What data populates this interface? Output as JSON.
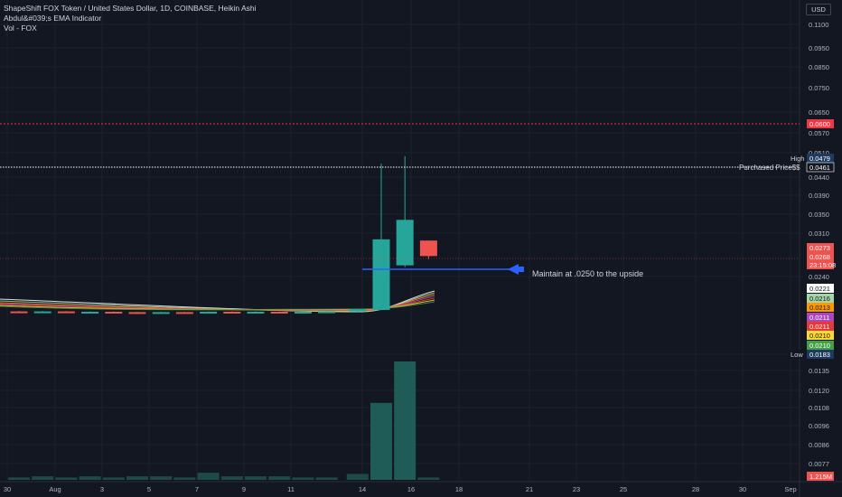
{
  "header": {
    "title_line": "ShapeShift FOX Token / United States Dollar, 1D, COINBASE, Heikin Ashi",
    "indicator_1": "Abdul&#039;s EMA Indicator",
    "indicator_2": "Vol - FOX",
    "currency": "USD"
  },
  "annotations": {
    "maintain_text": "Maintain at .0250 to the upside",
    "purchased_label": "Purchased Price$$",
    "high_label": "High",
    "low_label": "Low"
  },
  "colors": {
    "background": "#131722",
    "grid": "#1e222d",
    "up": "#26a69a",
    "down": "#ef5350",
    "horizontal_line": "#2962ff",
    "dotted_line_red": "#f23645",
    "dotted_line_white": "#ffffff"
  },
  "chart_data": {
    "type": "candlestick",
    "ylim": [
      0.0183,
      0.11
    ],
    "y_ticks": [
      "0.1100",
      "0.0950",
      "0.0850",
      "0.0750",
      "0.0650",
      "0.0570",
      "0.0510",
      "0.0440",
      "0.0390",
      "0.0350",
      "0.0310",
      "0.0240",
      "0.0183",
      "0.0135",
      "0.0120",
      "0.0108",
      "0.0096",
      "0.0086",
      "0.0077"
    ],
    "x_ticks": [
      "30",
      "Aug",
      "3",
      "5",
      "7",
      "9",
      "11",
      "14",
      "16",
      "18",
      "21",
      "23",
      "25",
      "28",
      "30",
      "Sep"
    ],
    "price_tags": [
      {
        "label": "",
        "value": "0.0600",
        "color": "#f23645"
      },
      {
        "label": "High",
        "value": "0.0479",
        "color": "#1e3a5f"
      },
      {
        "label": "Purchased Price$$",
        "value": "0.0461",
        "color": "#131722"
      },
      {
        "label": "",
        "value": "0.0273",
        "color": "#ef5350"
      },
      {
        "label": "",
        "value": "0.0268",
        "color": "#ef5350"
      },
      {
        "label": "",
        "value": "23:15:08",
        "color": "#ef5350"
      },
      {
        "label": "",
        "value": "0.0221",
        "color": "#ffffff"
      },
      {
        "label": "",
        "value": "0.0216",
        "color": "#a5d6a7"
      },
      {
        "label": "",
        "value": "0.0213",
        "color": "#ff9800"
      },
      {
        "label": "",
        "value": "0.0211",
        "color": "#ab47bc"
      },
      {
        "label": "",
        "value": "0.0211",
        "color": "#e53935"
      },
      {
        "label": "",
        "value": "0.0210",
        "color": "#fdd835"
      },
      {
        "label": "",
        "value": "0.0210",
        "color": "#43a047"
      },
      {
        "label": "Low",
        "value": "0.0183",
        "color": "#1e3a5f"
      },
      {
        "label": "",
        "value": "1.215M",
        "color": "#ef5350"
      }
    ],
    "candles_note": "Daily Heikin Ashi candles, roughly flat near 0.021 from late July until a spike on Aug 15-16 and a red candle on Aug 17",
    "candles": [
      {
        "date": "Jul 31",
        "open": 0.0212,
        "close": 0.0211,
        "high": 0.0213,
        "low": 0.0209
      },
      {
        "date": "Aug 1",
        "open": 0.0211,
        "close": 0.0212,
        "high": 0.0213,
        "low": 0.021
      },
      {
        "date": "Aug 2",
        "open": 0.0212,
        "close": 0.021,
        "high": 0.0213,
        "low": 0.0209
      },
      {
        "date": "Aug 3",
        "open": 0.021,
        "close": 0.0211,
        "high": 0.0212,
        "low": 0.0209
      },
      {
        "date": "Aug 4",
        "open": 0.0211,
        "close": 0.021,
        "high": 0.0212,
        "low": 0.0209
      },
      {
        "date": "Aug 5",
        "open": 0.021,
        "close": 0.0209,
        "high": 0.0211,
        "low": 0.0208
      },
      {
        "date": "Aug 6",
        "open": 0.0209,
        "close": 0.021,
        "high": 0.0211,
        "low": 0.0208
      },
      {
        "date": "Aug 7",
        "open": 0.021,
        "close": 0.0209,
        "high": 0.0211,
        "low": 0.0208
      },
      {
        "date": "Aug 8",
        "open": 0.0209,
        "close": 0.0211,
        "high": 0.0212,
        "low": 0.0208
      },
      {
        "date": "Aug 9",
        "open": 0.0211,
        "close": 0.021,
        "high": 0.0212,
        "low": 0.0209
      },
      {
        "date": "Aug 10",
        "open": 0.021,
        "close": 0.0211,
        "high": 0.0212,
        "low": 0.0209
      },
      {
        "date": "Aug 11",
        "open": 0.0211,
        "close": 0.021,
        "high": 0.0212,
        "low": 0.0209
      },
      {
        "date": "Aug 12",
        "open": 0.021,
        "close": 0.0211,
        "high": 0.0212,
        "low": 0.0209
      },
      {
        "date": "Aug 13",
        "open": 0.0211,
        "close": 0.0212,
        "high": 0.0213,
        "low": 0.021
      },
      {
        "date": "Aug 14",
        "open": 0.0212,
        "close": 0.0218,
        "high": 0.0219,
        "low": 0.0211
      },
      {
        "date": "Aug 15",
        "open": 0.0216,
        "close": 0.03,
        "high": 0.0479,
        "low": 0.0215
      },
      {
        "date": "Aug 16",
        "open": 0.0258,
        "close": 0.0338,
        "high": 0.05,
        "low": 0.0255
      },
      {
        "date": "Aug 17",
        "open": 0.0298,
        "close": 0.0273,
        "high": 0.0298,
        "low": 0.0268
      }
    ],
    "volume": [
      {
        "date": "Jul 31",
        "value": 0.02
      },
      {
        "date": "Aug 1",
        "value": 0.03
      },
      {
        "date": "Aug 2",
        "value": 0.02
      },
      {
        "date": "Aug 3",
        "value": 0.03
      },
      {
        "date": "Aug 4",
        "value": 0.02
      },
      {
        "date": "Aug 5",
        "value": 0.03
      },
      {
        "date": "Aug 6",
        "value": 0.03
      },
      {
        "date": "Aug 7",
        "value": 0.02
      },
      {
        "date": "Aug 8",
        "value": 0.06
      },
      {
        "date": "Aug 9",
        "value": 0.03
      },
      {
        "date": "Aug 10",
        "value": 0.03
      },
      {
        "date": "Aug 11",
        "value": 0.03
      },
      {
        "date": "Aug 12",
        "value": 0.02
      },
      {
        "date": "Aug 13",
        "value": 0.02
      },
      {
        "date": "Aug 14",
        "value": 0.05
      },
      {
        "date": "Aug 15",
        "value": 0.65
      },
      {
        "date": "Aug 16",
        "value": 1.0
      },
      {
        "date": "Aug 17",
        "value": 0.02
      }
    ]
  }
}
